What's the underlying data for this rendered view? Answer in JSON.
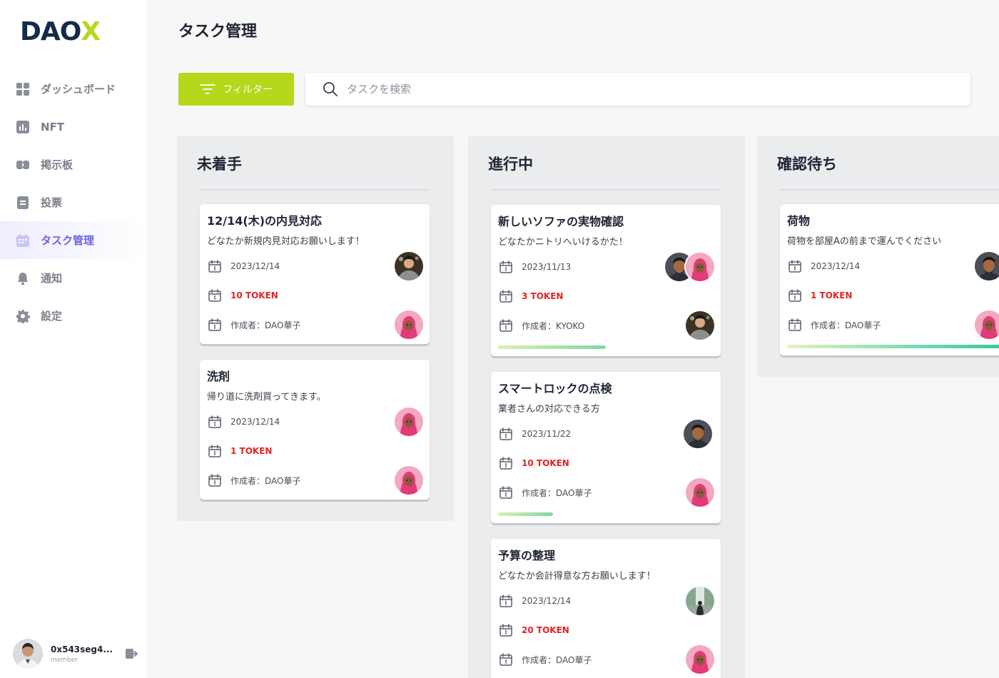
{
  "brand": {
    "logo_left": "DAO",
    "logo_x": "X",
    "accent": "#b6d81c",
    "navy": "#162a4a"
  },
  "sidebar": {
    "items": [
      {
        "label": "ダッシュボード",
        "icon": "dashboard-grid-icon",
        "active": false
      },
      {
        "label": "NFT",
        "icon": "chart-bars-icon",
        "active": false
      },
      {
        "label": "掲示板",
        "icon": "board-icon",
        "active": false
      },
      {
        "label": "投票",
        "icon": "vote-document-icon",
        "active": false
      },
      {
        "label": "タスク管理",
        "icon": "calendar-icon",
        "active": true
      },
      {
        "label": "通知",
        "icon": "bell-icon",
        "active": false
      },
      {
        "label": "設定",
        "icon": "gear-icon",
        "active": false
      }
    ],
    "active_color": "#6b63e6"
  },
  "user": {
    "name": "0x543seg4...",
    "role": "member",
    "logout_icon": "logout-icon"
  },
  "header": {
    "title": "タスク管理"
  },
  "toolbar": {
    "filter_label": "フィルター",
    "filter_icon": "filter-lines-icon",
    "search_placeholder": "タスクを検索",
    "search_icon": "search-icon"
  },
  "columns": [
    {
      "title": "未着手",
      "cards": [
        {
          "title": "12/14(木)の内見対応",
          "description": "どなたか新規内見対応お願いします！",
          "date": "2023/12/14",
          "token": "10 TOKEN",
          "author": "作成者：DAO華子"
        },
        {
          "title": "洗剤",
          "description": "帰り道に洗剤買ってきます。",
          "date": "2023/12/14",
          "token": "1 TOKEN",
          "author": "作成者：DAO華子"
        }
      ]
    },
    {
      "title": "進行中",
      "cards": [
        {
          "title": "新しいソファの実物確認",
          "description": "どなたかニトリへいけるかた！",
          "date": "2023/11/13",
          "token": "3 TOKEN",
          "author": "作成者：KYOKO",
          "progress": 0.47
        },
        {
          "title": "スマートロックの点検",
          "description": "業者さんの対応できる方",
          "date": "2023/11/22",
          "token": "10 TOKEN",
          "author": "作成者：DAO華子",
          "progress": 0.24
        },
        {
          "title": "予算の整理",
          "description": "どなたか会計得意な方お願いします！",
          "date": "2023/12/14",
          "token": "20 TOKEN",
          "author": "作成者：DAO華子"
        }
      ]
    },
    {
      "title": "確認待ち",
      "cards": [
        {
          "title": "荷物",
          "description": "荷物を部屋Aの前まで運んでください",
          "date": "2023/12/14",
          "token": "1 TOKEN",
          "author": "作成者：DAO華子",
          "progress": 1.0
        }
      ]
    }
  ],
  "colors": {
    "token_red": "#e02424",
    "column_bg": "#ebecee"
  }
}
